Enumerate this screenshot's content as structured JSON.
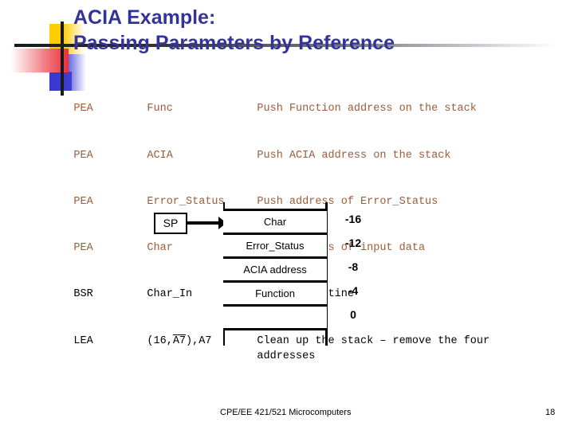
{
  "slide": {
    "title_lines": [
      "ACIA Example:",
      "Passing Parameters by Reference"
    ],
    "title_color": "#333399"
  },
  "code_listing": {
    "rows": [
      {
        "op": "PEA",
        "arg": "Func",
        "comment": "Push Function address on the stack",
        "color": "#9c5c38"
      },
      {
        "op": "PEA",
        "arg": "ACIA",
        "comment": "Push ACIA address on the stack",
        "color": "#9c5c38"
      },
      {
        "op": "PEA",
        "arg": "Error_Status",
        "comment": "Push address of Error_Status",
        "color": "#9c5c38"
      },
      {
        "op": "PEA",
        "arg": "Char",
        "comment": "Push address of input data",
        "color": "#9c5c38"
      },
      {
        "op": "BSR",
        "arg": "Char_In",
        "comment": "Call subroutine",
        "color": "#000000"
      },
      {
        "op": "LEA",
        "arg": "(16,A7),A7",
        "comment": "Clean up the stack – remove the four addresses",
        "color": "#000000"
      }
    ]
  },
  "stack_diagram": {
    "pointer_label": "SP",
    "cells": [
      {
        "label": "Char",
        "offset": "-16"
      },
      {
        "label": "Error_Status",
        "offset": "-12"
      },
      {
        "label": "ACIA address",
        "offset": "-8"
      },
      {
        "label": "Function",
        "offset": "-4"
      },
      {
        "label": "",
        "offset": "0"
      }
    ]
  },
  "footer": {
    "course": "CPE/EE 421/521 Microcomputers",
    "page_number": "18"
  }
}
